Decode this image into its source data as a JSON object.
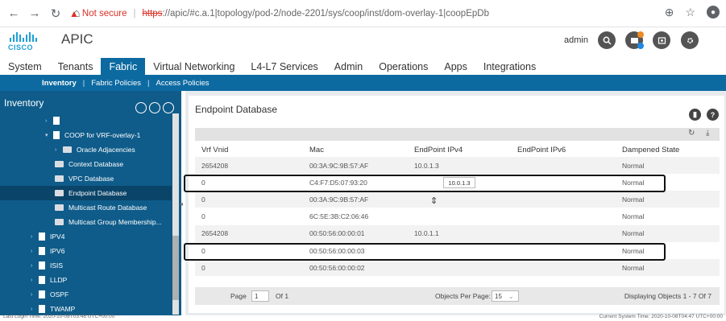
{
  "browser": {
    "not_secure": "Not secure",
    "url_https": "https",
    "url_rest": "://apic/#c.a.1|topology/pod-2/node-2201/sys/coop/inst/dom-overlay-1|coopEpDb"
  },
  "header": {
    "logo_text": "CISCO",
    "app_title": "APIC",
    "user": "admin",
    "notification_count": "1"
  },
  "tabs": [
    "System",
    "Tenants",
    "Fabric",
    "Virtual Networking",
    "L4-L7 Services",
    "Admin",
    "Operations",
    "Apps",
    "Integrations"
  ],
  "active_tab": "Fabric",
  "subnav": {
    "items": [
      "Inventory",
      "Fabric Policies",
      "Access Policies"
    ]
  },
  "sidebar": {
    "title": "Inventory",
    "tree": [
      {
        "label": "",
        "level": 1
      },
      {
        "label": "COOP for VRF-overlay-1",
        "level": 1
      },
      {
        "label": "Oracle Adjacencies",
        "level": 2
      },
      {
        "label": "Context Database",
        "level": 2
      },
      {
        "label": "VPC Database",
        "level": 2
      },
      {
        "label": "Endpoint Database",
        "level": 2,
        "selected": true
      },
      {
        "label": "Multicast Route Database",
        "level": 2
      },
      {
        "label": "Multicast Group Membership...",
        "level": 2
      },
      {
        "label": "IPV4",
        "level": 0
      },
      {
        "label": "IPV6",
        "level": 0
      },
      {
        "label": "ISIS",
        "level": 0
      },
      {
        "label": "LLDP",
        "level": 0
      },
      {
        "label": "OSPF",
        "level": 0
      },
      {
        "label": "TWAMP",
        "level": 0
      }
    ]
  },
  "panel": {
    "title": "Endpoint Database",
    "columns": [
      "Vrf Vnid",
      "Mac",
      "EndPoint IPv4",
      "EndPoint IPv6",
      "Dampened State"
    ],
    "rows": [
      [
        "2654208",
        "00:3A:9C:9B:57:AF",
        "10.0.1.3",
        "",
        "Normal"
      ],
      [
        "0",
        "C4:F7:D5:07:93:20",
        "",
        "",
        "Normal"
      ],
      [
        "0",
        "00:3A:9C:9B:57:AF",
        "",
        "",
        "Normal"
      ],
      [
        "0",
        "6C:5E:3B:C2:06:46",
        "",
        "",
        "Normal"
      ],
      [
        "2654208",
        "00:50:56:00:00:01",
        "10.0.1.1",
        "",
        "Normal"
      ],
      [
        "0",
        "00:50:56:00:00:03",
        "",
        "",
        "Normal"
      ],
      [
        "0",
        "00:50:56:00:00:02",
        "",
        "",
        "Normal"
      ]
    ],
    "tooltip": "10.0.1.3",
    "pager": {
      "page_label": "Page",
      "page_value": "1",
      "of_label": "Of 1",
      "per_page_label": "Objects Per Page:",
      "per_page_value": "15",
      "displaying": "Displaying Objects 1 - 7 Of 7"
    }
  },
  "footer": {
    "last_login": "Last Login Time: 2020-10-08T03:48 UTC+00:00",
    "current_time": "Current System Time: 2020-10-08T04:47 UTC+00:00"
  }
}
